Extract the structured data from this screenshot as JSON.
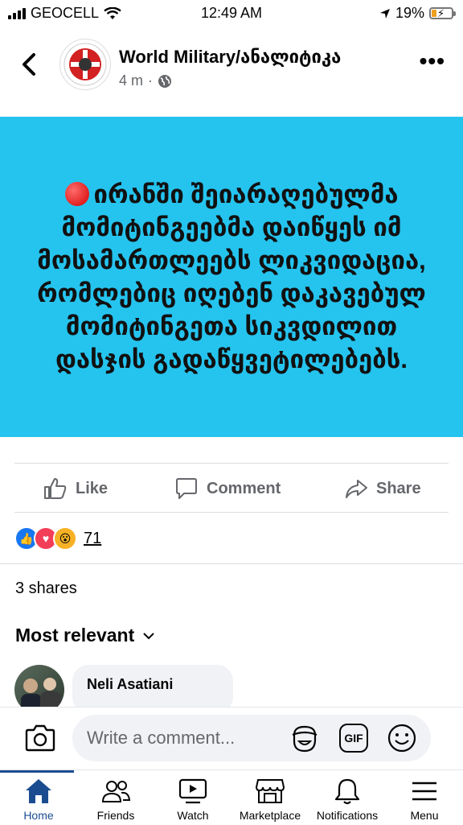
{
  "status_bar": {
    "carrier": "GEOCELL",
    "time": "12:49 AM",
    "battery": "19%"
  },
  "post": {
    "page_name": "World Military/ანალიტიკა",
    "time_ago": "4 m",
    "separator": "·",
    "text": "ირანში შეიარაღებულმა მომიტინგეებმა დაიწყეს იმ მოსამართლეებს ლიკვიდაცია, რომლებიც იღებენ დაკავებულ მომიტინგეთა სიკვდილით დასჯის გადაწყვეტილებებს.",
    "image_bg": "#25c4ef"
  },
  "actions": {
    "like": "Like",
    "comment": "Comment",
    "share": "Share"
  },
  "reactions": {
    "count": "71"
  },
  "shares": "3 shares",
  "sort": "Most relevant",
  "comment_preview": {
    "author": "Neli Asatiani"
  },
  "composer": {
    "placeholder": "Write a comment...",
    "gif": "GIF"
  },
  "nav": {
    "home": "Home",
    "friends": "Friends",
    "watch": "Watch",
    "marketplace": "Marketplace",
    "notifications": "Notifications",
    "menu": "Menu"
  },
  "colors": {
    "accent": "#1b4c90",
    "like_blue": "#1877f2"
  }
}
